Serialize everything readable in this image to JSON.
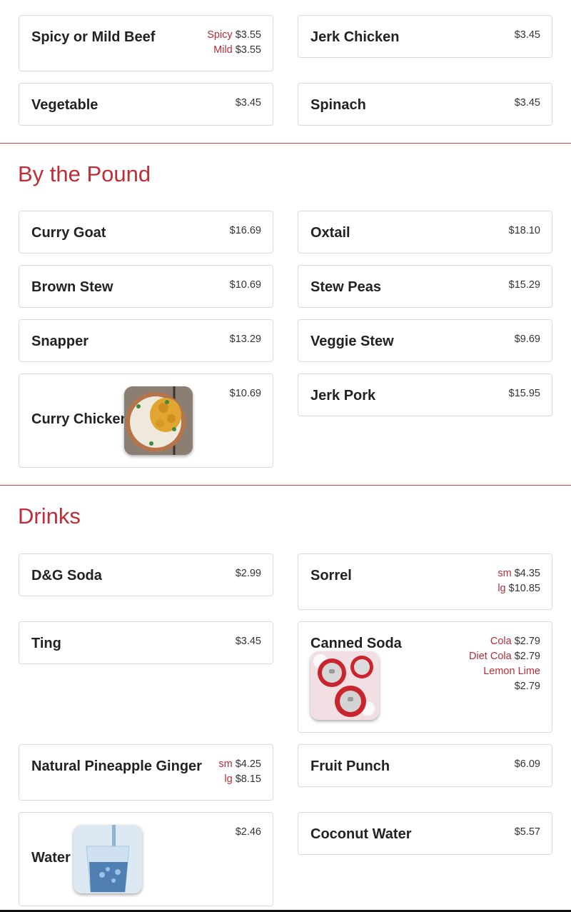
{
  "top_items": [
    {
      "name": "Spicy or Mild Beef",
      "prices": [
        {
          "label": "Spicy",
          "value": "$3.55"
        },
        {
          "label": "Mild",
          "value": "$3.55"
        }
      ]
    },
    {
      "name": "Jerk Chicken",
      "prices": [
        {
          "label": "",
          "value": "$3.45"
        }
      ]
    },
    {
      "name": "Vegetable",
      "prices": [
        {
          "label": "",
          "value": "$3.45"
        }
      ]
    },
    {
      "name": "Spinach",
      "prices": [
        {
          "label": "",
          "value": "$3.45"
        }
      ]
    }
  ],
  "pound": {
    "title": "By the Pound",
    "items": [
      {
        "name": "Curry Goat",
        "price": "$16.69"
      },
      {
        "name": "Oxtail",
        "price": "$18.10"
      },
      {
        "name": "Brown Stew",
        "price": "$10.69"
      },
      {
        "name": "Stew Peas",
        "price": "$15.29"
      },
      {
        "name": "Snapper",
        "price": "$13.29"
      },
      {
        "name": "Veggie Stew",
        "price": "$9.69"
      },
      {
        "name": "Curry Chicken",
        "price": "$10.69"
      },
      {
        "name": "Jerk Pork",
        "price": "$15.95"
      }
    ]
  },
  "drinks": {
    "title": "Drinks",
    "items": [
      {
        "name": "D&G Soda",
        "prices": [
          {
            "label": "",
            "value": "$2.99"
          }
        ]
      },
      {
        "name": "Sorrel",
        "prices": [
          {
            "label": "sm",
            "value": "$4.35"
          },
          {
            "label": "lg",
            "value": "$10.85"
          }
        ]
      },
      {
        "name": "Ting",
        "prices": [
          {
            "label": "",
            "value": "$3.45"
          }
        ]
      },
      {
        "name": "Canned Soda",
        "prices": [
          {
            "label": "Cola",
            "value": "$2.79"
          },
          {
            "label": "Diet Cola",
            "value": "$2.79"
          },
          {
            "label": "Lemon Lime",
            "value": ""
          },
          {
            "label": "",
            "value": "$2.79"
          }
        ]
      },
      {
        "name": "Natural Pineapple Ginger",
        "prices": [
          {
            "label": "sm",
            "value": "$4.25"
          },
          {
            "label": "lg",
            "value": "$8.15"
          }
        ]
      },
      {
        "name": "Fruit Punch",
        "prices": [
          {
            "label": "",
            "value": "$6.09"
          }
        ]
      },
      {
        "name": "Water",
        "prices": [
          {
            "label": "",
            "value": "$2.46"
          }
        ]
      },
      {
        "name": "Coconut Water",
        "prices": [
          {
            "label": "",
            "value": "$5.57"
          }
        ]
      }
    ]
  },
  "colors": {
    "accent": "#bf2d37",
    "label": "#b3303a",
    "border": "#dcdcdc"
  }
}
